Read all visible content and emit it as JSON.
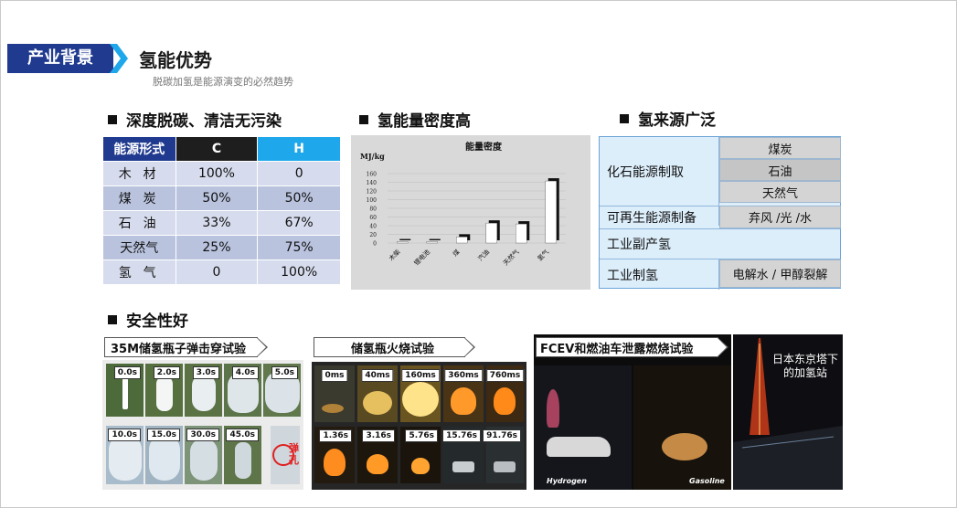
{
  "header": {
    "tag": "产业背景",
    "title": "氢能优势",
    "subtitle": "脱碳加氢是能源演变的必然趋势"
  },
  "sections": {
    "decarbon": "深度脱碳、清洁无污染",
    "density": "氢能量密度高",
    "sources": "氢来源广泛",
    "safety": "安全性好"
  },
  "energy_table": {
    "headers": [
      "能源形式",
      "C",
      "H"
    ],
    "rows": [
      [
        "木 材",
        "100%",
        "0"
      ],
      [
        "煤 炭",
        "50%",
        "50%"
      ],
      [
        "石 油",
        "33%",
        "67%"
      ],
      [
        "天然气",
        "25%",
        "75%"
      ],
      [
        "氢 气",
        "0",
        "100%"
      ]
    ]
  },
  "chart_data": {
    "type": "bar",
    "title": "能量密度",
    "ylabel": "MJ/kg",
    "ylim": [
      0,
      160
    ],
    "yticks": [
      0,
      20,
      40,
      60,
      80,
      100,
      120,
      140,
      160
    ],
    "yticks_shown": [
      "160",
      "140",
      "120",
      "100",
      "80",
      "60",
      "40",
      "20",
      "0"
    ],
    "categories": [
      "木柴",
      "锂电池",
      "煤",
      "汽油",
      "天然气",
      "氢气"
    ],
    "values": [
      3,
      3,
      14,
      46,
      44,
      143
    ]
  },
  "source_table": {
    "fossil": "化石能源制取",
    "fossil_items": [
      "煤炭",
      "石油",
      "天然气"
    ],
    "renewable": "可再生能源制备",
    "renewable_item": "弃风 /光 /水",
    "byproduct": "工业副产氢",
    "industrial": "工业制氢",
    "industrial_item": "电解水 / 甲醇裂解"
  },
  "safety": {
    "panel1": {
      "title": "35M储氢瓶子弹击穿试验",
      "times": [
        "0.0s",
        "2.0s",
        "3.0s",
        "4.0s",
        "5.0s",
        "10.0s",
        "15.0s",
        "30.0s",
        "45.0s"
      ],
      "hole_label": "弹孔"
    },
    "panel2": {
      "title": "储氢瓶火烧试验",
      "times": [
        "0ms",
        "40ms",
        "160ms",
        "360ms",
        "760ms",
        "1.36s",
        "3.16s",
        "5.76s",
        "15.76s",
        "91.76s"
      ]
    },
    "panel3": {
      "title": "FCEV和燃油车泄露燃烧试验",
      "left_label": "Hydrogen",
      "right_label": "Gasoline"
    },
    "panel4": {
      "caption": "日本东京塔下的加氢站"
    }
  },
  "colors": {
    "brand_blue": "#1f3a8f",
    "h_cyan": "#1ea7ea"
  }
}
